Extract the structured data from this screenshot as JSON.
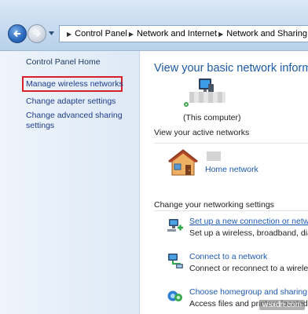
{
  "nav": {
    "back_icon": "back-arrow-icon",
    "forward_icon": "forward-arrow-icon",
    "recent_icon": "chevron-down-icon"
  },
  "breadcrumb": {
    "root_icon": "control-panel-icon",
    "items": [
      "Control Panel",
      "Network and Internet",
      "Network and Sharing Center"
    ]
  },
  "sidebar": {
    "home": "Control Panel Home",
    "items": [
      {
        "label": "Manage wireless networks",
        "highlighted": true
      },
      {
        "label": "Change adapter settings"
      },
      {
        "label": "Change advanced sharing settings"
      }
    ]
  },
  "main": {
    "title": "View your basic network information and set up connections",
    "computer": {
      "icon": "computer-icon",
      "label": "(This computer)"
    },
    "active_heading": "View your active networks",
    "network": {
      "icon": "home-network-icon",
      "type_link": "Home network"
    },
    "change_heading": "Change your networking settings",
    "tasks": [
      {
        "icon": "new-connection-icon",
        "link": "Set up a new connection or network",
        "desc": "Set up a wireless, broadband, dial-up, ad hoc, or VPN connection"
      },
      {
        "icon": "connect-network-icon",
        "link": "Connect to a network",
        "desc": "Connect or reconnect to a wireless, wired, dial-up, or VPN network connection"
      },
      {
        "icon": "homegroup-icon",
        "link": "Choose homegroup and sharing options",
        "desc": "Access files and printers located on other network computers"
      }
    ]
  },
  "watermark": "wsxdn.com",
  "colors": {
    "link": "#1e5ab4",
    "title": "#1c5aa6",
    "highlight_box": "#d8202a",
    "sidebar_bg": "#dde9f6"
  }
}
